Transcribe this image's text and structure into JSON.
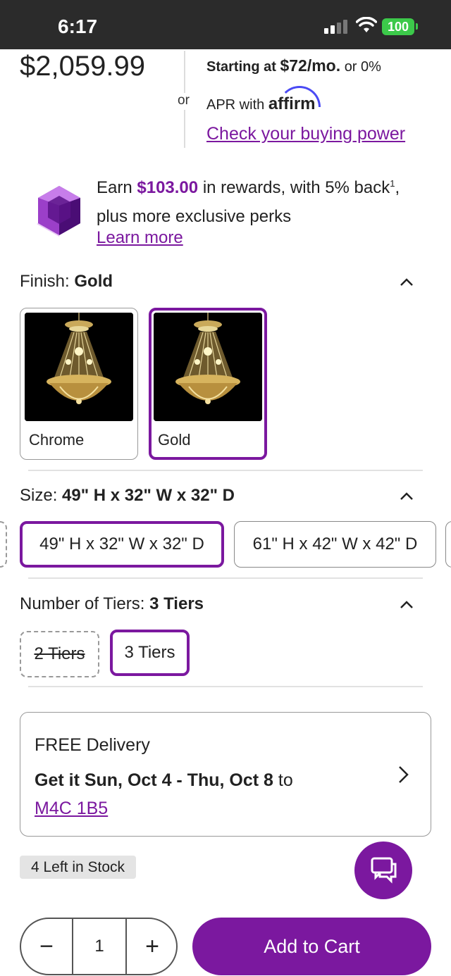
{
  "status_bar": {
    "time": "6:17",
    "battery": "100"
  },
  "price": {
    "amount": "$2,059.99",
    "or": "or"
  },
  "financing": {
    "starting_prefix": "Starting at",
    "starting_amount": "$72/mo.",
    "suffix": "or 0%",
    "line2": "APR with",
    "brand": "affirm",
    "buying_power": "Check your buying power"
  },
  "rewards": {
    "earn": "Earn",
    "amount": "$103.00",
    "middle": "in rewards, with 5% back",
    "superscript": "1",
    "rest": ", plus more exclusive perks",
    "learn_more": "Learn more",
    "icon": "purple-gem-icon"
  },
  "finish": {
    "label": "Finish:",
    "selected": "Gold",
    "options": [
      {
        "label": "Chrome",
        "selected": false
      },
      {
        "label": "Gold",
        "selected": true
      }
    ]
  },
  "size": {
    "label": "Size:",
    "selected": "49\" H x 32\" W x 32\" D",
    "options": [
      {
        "label": "49\" H x 32\" W x 32\" D",
        "selected": true
      },
      {
        "label": "61\" H x 42\" W x 42\" D",
        "selected": false
      }
    ]
  },
  "tiers": {
    "label": "Number of Tiers:",
    "selected": "3 Tiers",
    "options": [
      {
        "label": "2 Tiers",
        "selected": false,
        "available": false
      },
      {
        "label": "3 Tiers",
        "selected": true,
        "available": true
      }
    ]
  },
  "delivery": {
    "title": "FREE Delivery",
    "get_it": "Get it Sun, Oct 4 - Thu, Oct 8",
    "to": "to",
    "postal": "M4C 1B5"
  },
  "stock": {
    "label": "4 Left in Stock"
  },
  "quantity": {
    "minus": "−",
    "value": "1",
    "plus": "+"
  },
  "cart": {
    "label": "Add to Cart"
  },
  "colors": {
    "accent": "#7b189f",
    "battery": "#3cc94a",
    "status_bar": "#2b2b2b"
  }
}
